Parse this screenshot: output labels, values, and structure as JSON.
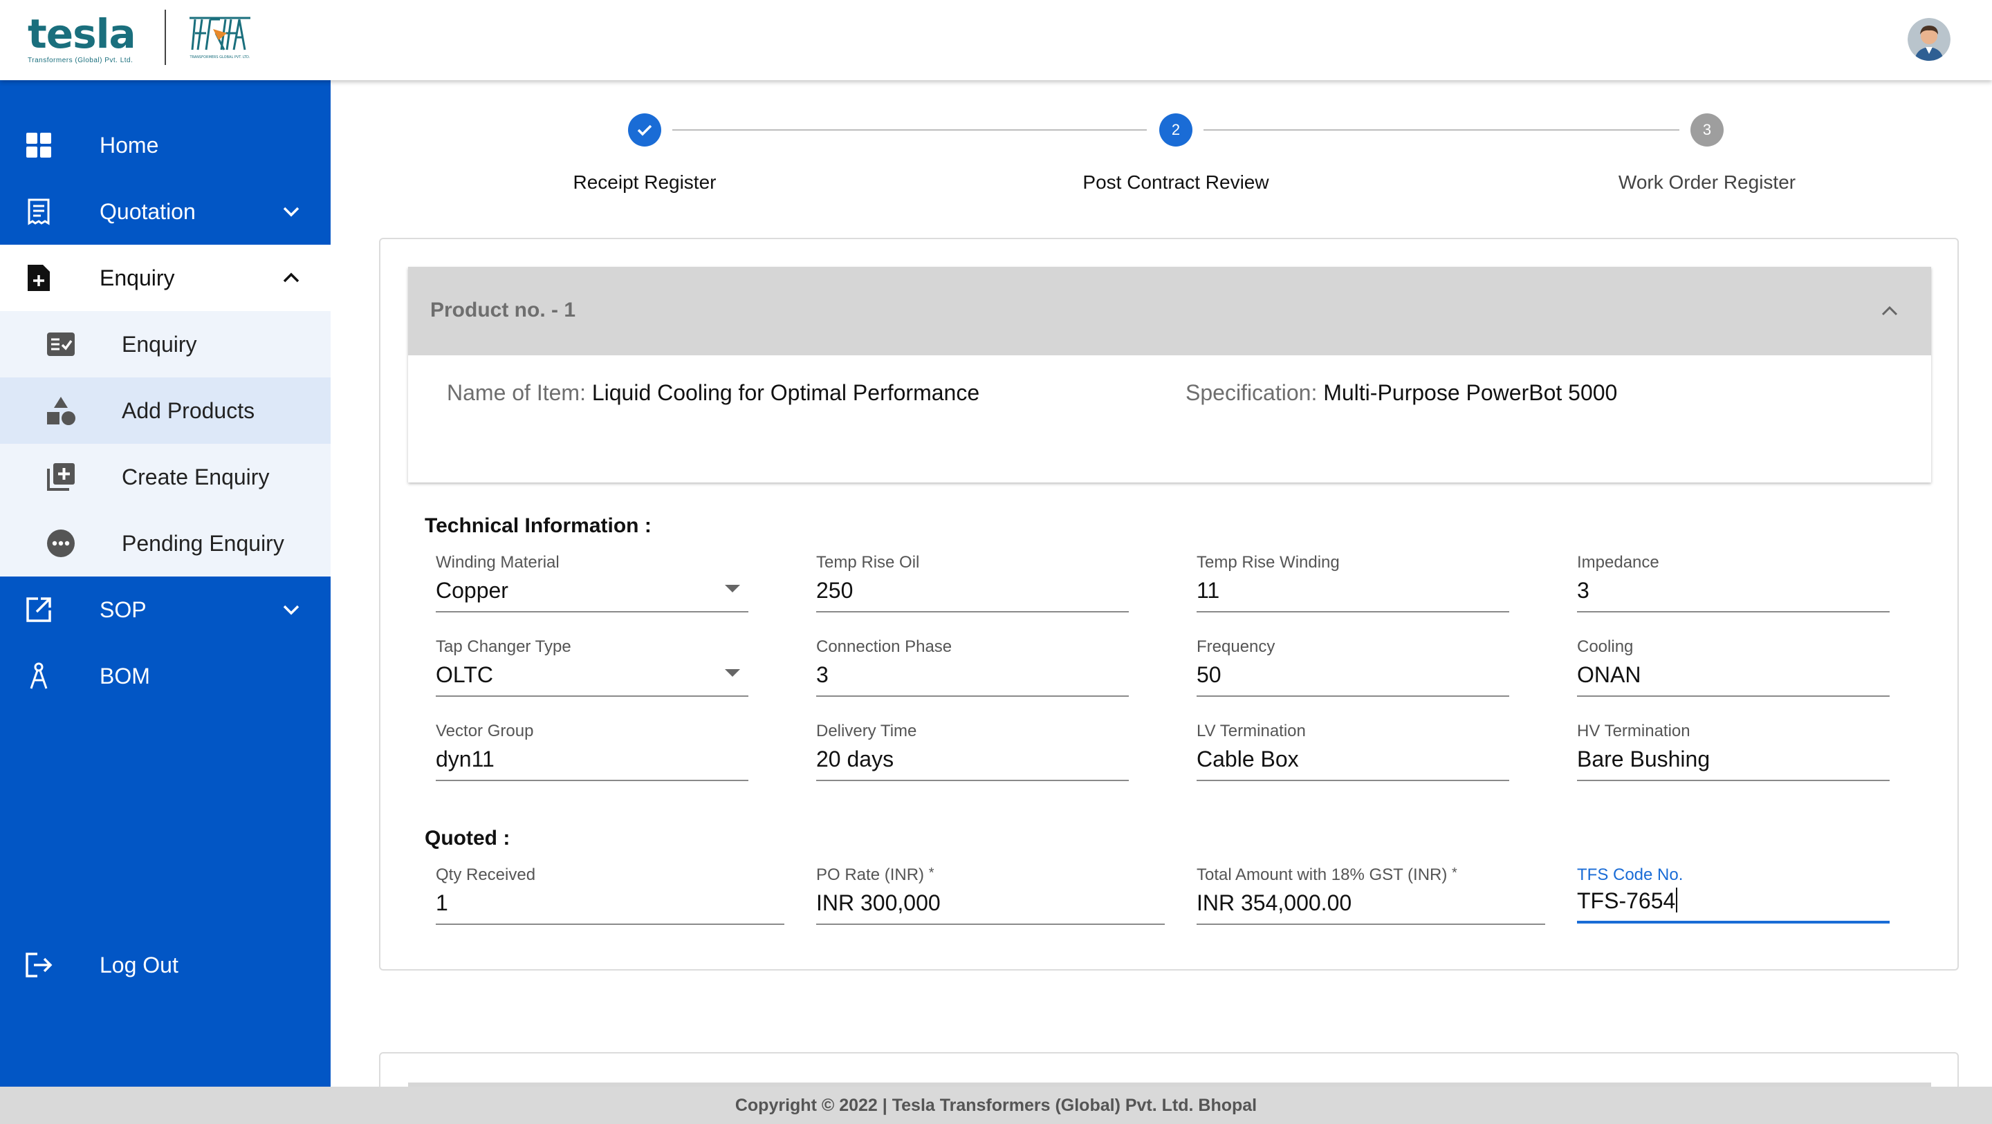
{
  "brand": {
    "name": "tesla",
    "subtitle": "Transformers (Global) Pvt. Ltd.",
    "secondary_logo_text": "TRANSFORMERS GLOBAL PVT. LTD.",
    "color": "#1a6f7d"
  },
  "colors": {
    "sidebar": "#0256c5",
    "accent": "#1a6cd6",
    "step_done": "#1a6cd6",
    "step_pending": "#9e9e9e"
  },
  "sidebar": {
    "items": [
      {
        "label": "Home",
        "icon": "grid-icon"
      },
      {
        "label": "Quotation",
        "icon": "receipt-icon"
      },
      {
        "label": "Enquiry",
        "icon": "file-plus-icon",
        "expanded": true
      },
      {
        "label": "SOP",
        "icon": "open-external-icon"
      },
      {
        "label": "BOM",
        "icon": "compass-icon"
      }
    ],
    "enquiry_sub": [
      {
        "label": "Enquiry",
        "icon": "checklist-icon"
      },
      {
        "label": "Add Products",
        "icon": "shapes-icon",
        "active": true
      },
      {
        "label": "Create Enquiry",
        "icon": "add-box-icon"
      },
      {
        "label": "Pending Enquiry",
        "icon": "more-circle-icon"
      }
    ],
    "logout": "Log Out"
  },
  "stepper": [
    {
      "label": "Receipt Register",
      "state": "done",
      "number": "1"
    },
    {
      "label": "Post Contract Review",
      "state": "active",
      "number": "2"
    },
    {
      "label": "Work Order Register",
      "state": "pending",
      "number": "3"
    }
  ],
  "product": {
    "title": "Product no. - 1",
    "name_key": "Name of Item:",
    "name_value": "Liquid Cooling for Optimal Performance",
    "spec_key": "Specification:",
    "spec_value": "Multi-Purpose PowerBot 5000"
  },
  "technical": {
    "title": "Technical Information :",
    "fields": [
      {
        "label": "Winding Material",
        "value": "Copper",
        "select": true
      },
      {
        "label": "Temp Rise Oil",
        "value": "250"
      },
      {
        "label": "Temp Rise Winding",
        "value": "11"
      },
      {
        "label": "Impedance",
        "value": "3"
      },
      {
        "label": "Tap Changer Type",
        "value": "OLTC",
        "select": true
      },
      {
        "label": "Connection Phase",
        "value": "3"
      },
      {
        "label": "Frequency",
        "value": "50"
      },
      {
        "label": "Cooling",
        "value": "ONAN"
      },
      {
        "label": "Vector Group",
        "value": "dyn11"
      },
      {
        "label": "Delivery Time",
        "value": "20 days"
      },
      {
        "label": "LV Termination",
        "value": "Cable Box"
      },
      {
        "label": "HV Termination",
        "value": "Bare Bushing"
      }
    ]
  },
  "quoted": {
    "title": "Quoted :",
    "required_mark": "*",
    "fields": [
      {
        "label": "Qty Received",
        "value": "1"
      },
      {
        "label": "PO Rate (INR)",
        "value": "INR 300,000",
        "required": true
      },
      {
        "label": "Total Amount with 18% GST (INR)",
        "value": "INR 354,000.00",
        "required": true
      },
      {
        "label": "TFS Code No.",
        "value": "TFS-7654",
        "focused": true
      }
    ]
  },
  "footer": "Copyright © 2022 | Tesla Transformers (Global) Pvt. Ltd. Bhopal"
}
